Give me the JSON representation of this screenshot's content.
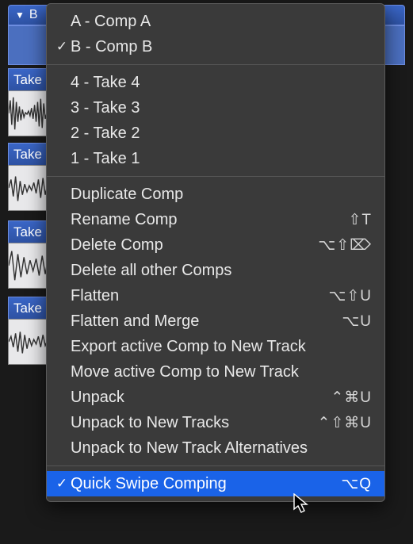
{
  "track": {
    "header": "B",
    "takes": [
      "Take",
      "Take",
      "Take",
      "Take"
    ]
  },
  "menu": {
    "comps": [
      {
        "label": "A - Comp A",
        "checked": false
      },
      {
        "label": "B - Comp B",
        "checked": true
      }
    ],
    "takes": [
      {
        "label": "4 - Take 4"
      },
      {
        "label": "3 - Take 3"
      },
      {
        "label": "2 - Take 2"
      },
      {
        "label": "1 - Take 1"
      }
    ],
    "actions": [
      {
        "label": "Duplicate Comp",
        "shortcut": ""
      },
      {
        "label": "Rename Comp",
        "shortcut": "⇧T"
      },
      {
        "label": "Delete Comp",
        "shortcut": "⌥⇧⌦"
      },
      {
        "label": "Delete all other Comps",
        "shortcut": ""
      },
      {
        "label": "Flatten",
        "shortcut": "⌥⇧U"
      },
      {
        "label": "Flatten and Merge",
        "shortcut": "⌥U"
      },
      {
        "label": "Export active Comp to New Track",
        "shortcut": ""
      },
      {
        "label": "Move active Comp to New Track",
        "shortcut": ""
      },
      {
        "label": "Unpack",
        "shortcut": "⌃⌘U"
      },
      {
        "label": "Unpack to New Tracks",
        "shortcut": "⌃⇧⌘U"
      },
      {
        "label": "Unpack to New Track Alternatives",
        "shortcut": ""
      }
    ],
    "quickSwipe": {
      "label": "Quick Swipe Comping",
      "shortcut": "⌥Q",
      "checked": true
    }
  }
}
